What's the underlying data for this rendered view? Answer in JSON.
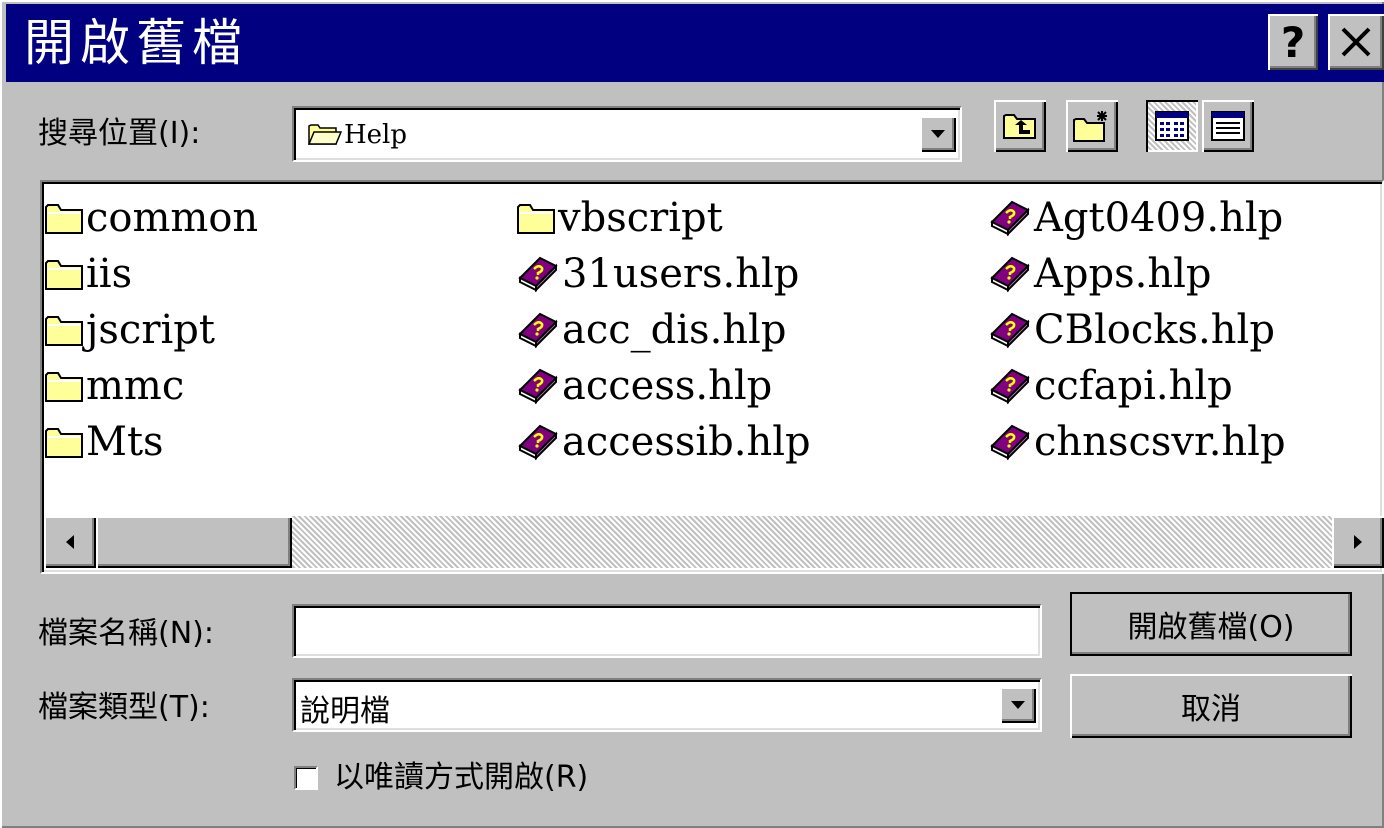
{
  "dialog": {
    "title": "開啟舊檔",
    "help_button": "?",
    "close_button": "✕"
  },
  "look_in": {
    "label": "搜尋位置(I):",
    "value": "Help"
  },
  "toolbar": {
    "up_one_level": "up-folder-icon",
    "create_new_folder": "new-folder-icon",
    "list_view": "list-view-icon",
    "details_view": "details-view-icon"
  },
  "files": {
    "column1": [
      {
        "name": "common",
        "icon": "folder-icon"
      },
      {
        "name": "iis",
        "icon": "folder-icon"
      },
      {
        "name": "jscript",
        "icon": "folder-icon"
      },
      {
        "name": "mmc",
        "icon": "folder-icon"
      },
      {
        "name": "Mts",
        "icon": "folder-icon"
      }
    ],
    "column2": [
      {
        "name": "vbscript",
        "icon": "folder-icon"
      },
      {
        "name": "31users.hlp",
        "icon": "help-book-icon"
      },
      {
        "name": "acc_dis.hlp",
        "icon": "help-book-icon"
      },
      {
        "name": "access.hlp",
        "icon": "help-book-icon"
      },
      {
        "name": "accessib.hlp",
        "icon": "help-book-icon"
      }
    ],
    "column3": [
      {
        "name": "Agt0409.hlp",
        "icon": "help-book-icon"
      },
      {
        "name": "Apps.hlp",
        "icon": "help-book-icon"
      },
      {
        "name": "CBlocks.hlp",
        "icon": "help-book-icon"
      },
      {
        "name": "ccfapi.hlp",
        "icon": "help-book-icon"
      },
      {
        "name": "chnscsvr.hlp",
        "icon": "help-book-icon"
      }
    ]
  },
  "file_name": {
    "label": "檔案名稱(N):",
    "value": ""
  },
  "file_type": {
    "label": "檔案類型(T):",
    "value": "說明檔"
  },
  "read_only": {
    "label": "以唯讀方式開啟(R)",
    "checked": false
  },
  "buttons": {
    "open": "開啟舊檔(O)",
    "cancel": "取消"
  },
  "colors": {
    "title_bar": "#000080",
    "dialog_face": "#c0c0c0",
    "folder": "#ffff99",
    "help_book": "#800080"
  }
}
